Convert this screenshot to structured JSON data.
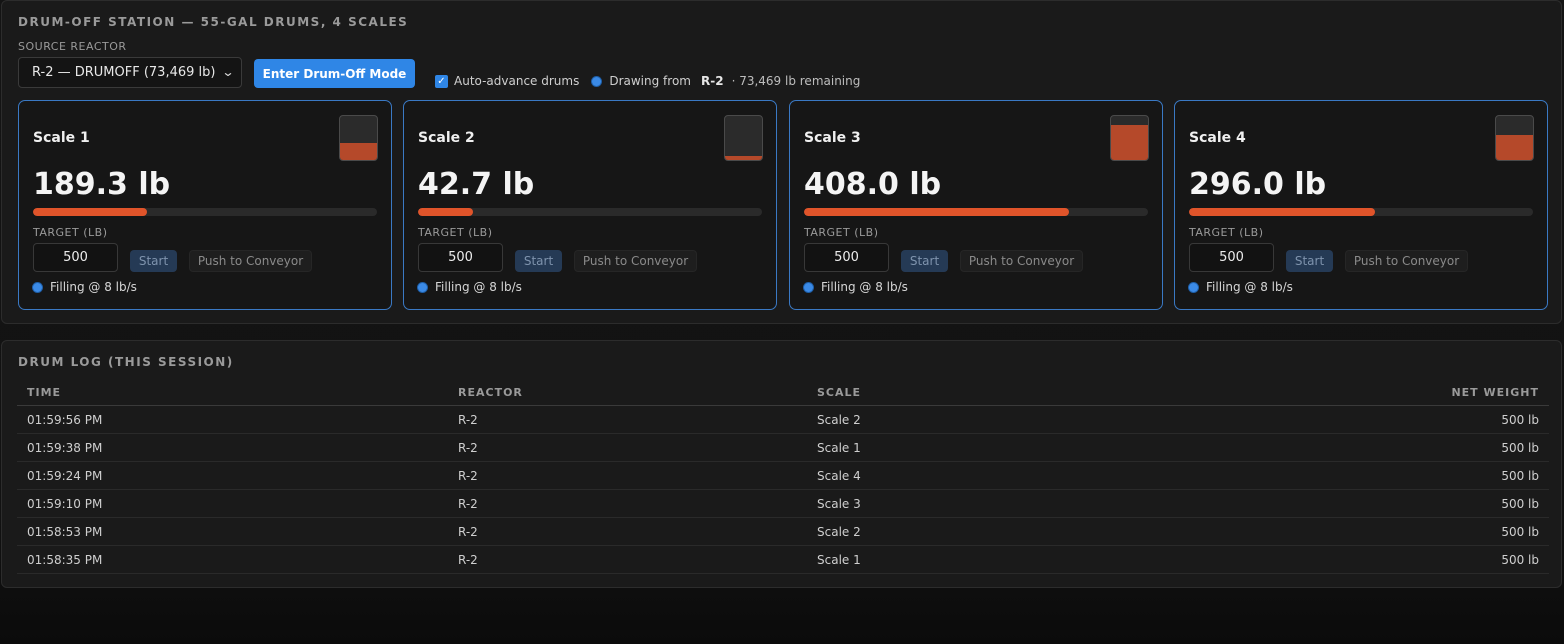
{
  "station": {
    "title": "DRUM-OFF STATION — 55-GAL DRUMS, 4 SCALES",
    "source_label": "SOURCE REACTOR",
    "reactor_select": "R-2 — DRUMOFF (73,469 lb)",
    "enter_button": "Enter Drum-Off Mode",
    "auto_advance_label": "Auto-advance drums",
    "auto_advance_checked": true,
    "drawing_prefix": "Drawing from",
    "drawing_reactor": "R-2",
    "drawing_remaining": "· 73,469 lb remaining",
    "accent_color": "#2f86e6",
    "progress_color": "#e0542a"
  },
  "scales": [
    {
      "name": "Scale 1",
      "weight": "189.3 lb",
      "progress_fraction": 0.33,
      "drum_fill": 0.38,
      "target_label": "TARGET (LB)",
      "target": "500",
      "start_label": "Start",
      "push_label": "Push to Conveyor",
      "status": "Filling @ 8 lb/s"
    },
    {
      "name": "Scale 2",
      "weight": "42.7 lb",
      "progress_fraction": 0.16,
      "drum_fill": 0.09,
      "target_label": "TARGET (LB)",
      "target": "500",
      "start_label": "Start",
      "push_label": "Push to Conveyor",
      "status": "Filling @ 8 lb/s"
    },
    {
      "name": "Scale 3",
      "weight": "408.0 lb",
      "progress_fraction": 0.77,
      "drum_fill": 0.8,
      "target_label": "TARGET (LB)",
      "target": "500",
      "start_label": "Start",
      "push_label": "Push to Conveyor",
      "status": "Filling @ 8 lb/s"
    },
    {
      "name": "Scale 4",
      "weight": "296.0 lb",
      "progress_fraction": 0.54,
      "drum_fill": 0.57,
      "target_label": "TARGET (LB)",
      "target": "500",
      "start_label": "Start",
      "push_label": "Push to Conveyor",
      "status": "Filling @ 8 lb/s"
    }
  ],
  "log": {
    "title": "DRUM LOG (THIS SESSION)",
    "columns": [
      "TIME",
      "REACTOR",
      "SCALE",
      "NET WEIGHT"
    ],
    "rows": [
      [
        "01:59:56 PM",
        "R-2",
        "Scale 2",
        "500 lb"
      ],
      [
        "01:59:38 PM",
        "R-2",
        "Scale 1",
        "500 lb"
      ],
      [
        "01:59:24 PM",
        "R-2",
        "Scale 4",
        "500 lb"
      ],
      [
        "01:59:10 PM",
        "R-2",
        "Scale 3",
        "500 lb"
      ],
      [
        "01:58:53 PM",
        "R-2",
        "Scale 2",
        "500 lb"
      ],
      [
        "01:58:35 PM",
        "R-2",
        "Scale 1",
        "500 lb"
      ]
    ]
  },
  "icons": {
    "chevron": "chevron-down-icon",
    "checkbox": "checkbox-checked-icon",
    "status_dot": "status-dot-icon",
    "drum": "drum-fill-icon"
  }
}
